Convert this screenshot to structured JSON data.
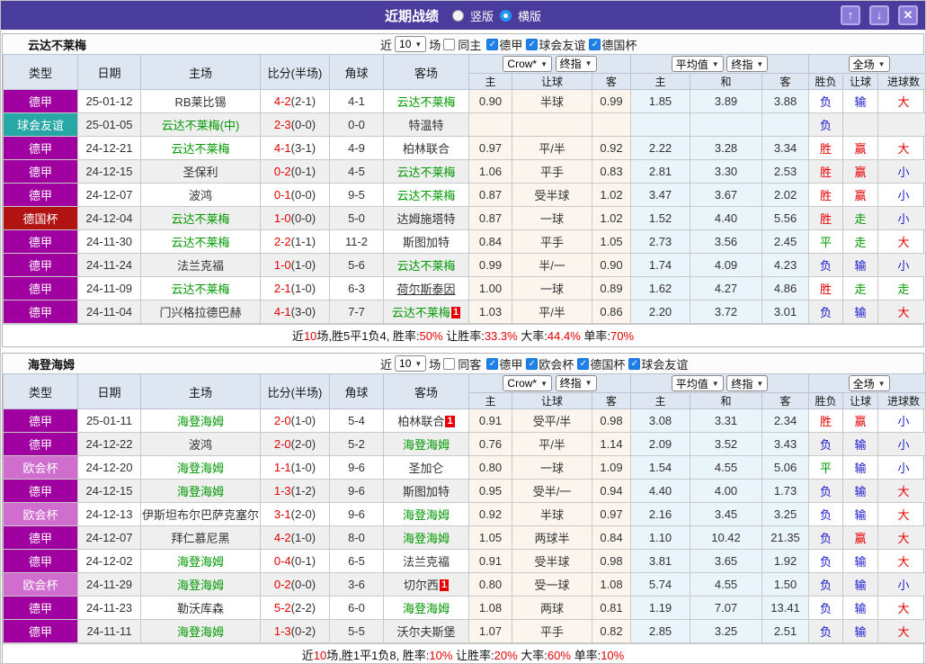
{
  "titlebar": {
    "title": "近期战绩",
    "radios": [
      {
        "label": "竖版",
        "selected": false
      },
      {
        "label": "横版",
        "selected": true
      }
    ],
    "buttons": [
      {
        "id": "up",
        "glyph": "↑"
      },
      {
        "id": "down",
        "glyph": "↓"
      },
      {
        "id": "close",
        "glyph": "✕"
      }
    ]
  },
  "headers": {
    "static": [
      "类型",
      "日期",
      "主场",
      "比分(半场)",
      "角球",
      "客场"
    ],
    "g1": {
      "selects": [
        "Crow*",
        "终指"
      ],
      "cols": [
        "主",
        "让球",
        "客"
      ]
    },
    "g2": {
      "selects": [
        "平均值",
        "终指"
      ],
      "cols": [
        "主",
        "和",
        "客"
      ]
    },
    "g3": {
      "selects": [
        "全场"
      ],
      "cols": [
        "胜负",
        "让球",
        "进球数"
      ]
    }
  },
  "colors": {
    "titlebar": "#4a3c9c",
    "league": {
      "德甲": "#a000a0",
      "球会友谊": "#28a7a7",
      "德国杯": "#b11212",
      "欧会杯": "#cf6ece"
    },
    "result": {
      "r": "#e60000",
      "b": "#1919cc",
      "g": "#009900"
    },
    "team_highlight": "#009900",
    "score_red": "#e60000"
  },
  "sections": [
    {
      "team": "云达不莱梅",
      "filter": {
        "near": "近",
        "count": "10",
        "unit": "场",
        "same_label": "同主",
        "same_checked": false,
        "leagues": [
          "德甲",
          "球会友谊",
          "德国杯"
        ]
      },
      "rows": [
        {
          "type": "德甲",
          "date": "25-01-12",
          "home": {
            "t": "RB莱比锡",
            "s": "n"
          },
          "score": {
            "m": "4-2",
            "h": "(2-1)"
          },
          "corners": "4-1",
          "away": {
            "t": "云达不莱梅",
            "s": "g"
          },
          "odds": [
            "0.90",
            "半球",
            "0.99"
          ],
          "avg": [
            "1.85",
            "3.89",
            "3.88"
          ],
          "res": [
            {
              "t": "负",
              "c": "b"
            },
            {
              "t": "输",
              "c": "b"
            },
            {
              "t": "大",
              "c": "r"
            }
          ]
        },
        {
          "type": "球会友谊",
          "date": "25-01-05",
          "home": {
            "t": "云达不莱梅(中)",
            "s": "g"
          },
          "score": {
            "m": "2-3",
            "h": "(0-0)"
          },
          "corners": "0-0",
          "away": {
            "t": "特温特",
            "s": "n"
          },
          "odds": [
            "",
            "",
            ""
          ],
          "avg": [
            "",
            "",
            ""
          ],
          "res": [
            {
              "t": "负",
              "c": "b"
            },
            {
              "t": "",
              "c": ""
            },
            {
              "t": "",
              "c": ""
            }
          ]
        },
        {
          "type": "德甲",
          "date": "24-12-21",
          "home": {
            "t": "云达不莱梅",
            "s": "g"
          },
          "score": {
            "m": "4-1",
            "h": "(3-1)"
          },
          "corners": "4-9",
          "away": {
            "t": "柏林联合",
            "s": "n"
          },
          "odds": [
            "0.97",
            "平/半",
            "0.92"
          ],
          "avg": [
            "2.22",
            "3.28",
            "3.34"
          ],
          "res": [
            {
              "t": "胜",
              "c": "r"
            },
            {
              "t": "赢",
              "c": "r"
            },
            {
              "t": "大",
              "c": "r"
            }
          ]
        },
        {
          "type": "德甲",
          "date": "24-12-15",
          "home": {
            "t": "圣保利",
            "s": "n"
          },
          "score": {
            "m": "0-2",
            "h": "(0-1)"
          },
          "corners": "4-5",
          "away": {
            "t": "云达不莱梅",
            "s": "g"
          },
          "odds": [
            "1.06",
            "平手",
            "0.83"
          ],
          "avg": [
            "2.81",
            "3.30",
            "2.53"
          ],
          "res": [
            {
              "t": "胜",
              "c": "r"
            },
            {
              "t": "赢",
              "c": "r"
            },
            {
              "t": "小",
              "c": "b"
            }
          ]
        },
        {
          "type": "德甲",
          "date": "24-12-07",
          "home": {
            "t": "波鸿",
            "s": "n"
          },
          "score": {
            "m": "0-1",
            "h": "(0-0)"
          },
          "corners": "9-5",
          "away": {
            "t": "云达不莱梅",
            "s": "g"
          },
          "odds": [
            "0.87",
            "受半球",
            "1.02"
          ],
          "avg": [
            "3.47",
            "3.67",
            "2.02"
          ],
          "res": [
            {
              "t": "胜",
              "c": "r"
            },
            {
              "t": "赢",
              "c": "r"
            },
            {
              "t": "小",
              "c": "b"
            }
          ]
        },
        {
          "type": "德国杯",
          "date": "24-12-04",
          "home": {
            "t": "云达不莱梅",
            "s": "g"
          },
          "score": {
            "m": "1-0",
            "h": "(0-0)"
          },
          "corners": "5-0",
          "away": {
            "t": "达姆施塔特",
            "s": "n"
          },
          "odds": [
            "0.87",
            "一球",
            "1.02"
          ],
          "avg": [
            "1.52",
            "4.40",
            "5.56"
          ],
          "res": [
            {
              "t": "胜",
              "c": "r"
            },
            {
              "t": "走",
              "c": "g"
            },
            {
              "t": "小",
              "c": "b"
            }
          ]
        },
        {
          "type": "德甲",
          "date": "24-11-30",
          "home": {
            "t": "云达不莱梅",
            "s": "g"
          },
          "score": {
            "m": "2-2",
            "h": "(1-1)"
          },
          "corners": "11-2",
          "away": {
            "t": "斯图加特",
            "s": "n"
          },
          "odds": [
            "0.84",
            "平手",
            "1.05"
          ],
          "avg": [
            "2.73",
            "3.56",
            "2.45"
          ],
          "res": [
            {
              "t": "平",
              "c": "g"
            },
            {
              "t": "走",
              "c": "g"
            },
            {
              "t": "大",
              "c": "r"
            }
          ]
        },
        {
          "type": "德甲",
          "date": "24-11-24",
          "home": {
            "t": "法兰克福",
            "s": "n"
          },
          "score": {
            "m": "1-0",
            "h": "(1-0)"
          },
          "corners": "5-6",
          "away": {
            "t": "云达不莱梅",
            "s": "g"
          },
          "odds": [
            "0.99",
            "半/一",
            "0.90"
          ],
          "avg": [
            "1.74",
            "4.09",
            "4.23"
          ],
          "res": [
            {
              "t": "负",
              "c": "b"
            },
            {
              "t": "输",
              "c": "b"
            },
            {
              "t": "小",
              "c": "b"
            }
          ]
        },
        {
          "type": "德甲",
          "date": "24-11-09",
          "home": {
            "t": "云达不莱梅",
            "s": "g"
          },
          "score": {
            "m": "2-1",
            "h": "(1-0)"
          },
          "corners": "6-3",
          "away": {
            "t": "荷尔斯泰因",
            "s": "u"
          },
          "odds": [
            "1.00",
            "一球",
            "0.89"
          ],
          "avg": [
            "1.62",
            "4.27",
            "4.86"
          ],
          "res": [
            {
              "t": "胜",
              "c": "r"
            },
            {
              "t": "走",
              "c": "g"
            },
            {
              "t": "走",
              "c": "g"
            }
          ]
        },
        {
          "type": "德甲",
          "date": "24-11-04",
          "home": {
            "t": "门兴格拉德巴赫",
            "s": "n"
          },
          "score": {
            "m": "4-1",
            "h": "(3-0)"
          },
          "corners": "7-7",
          "away": {
            "t": "云达不莱梅",
            "s": "g",
            "b": "1"
          },
          "odds": [
            "1.03",
            "平/半",
            "0.86"
          ],
          "avg": [
            "2.20",
            "3.72",
            "3.01"
          ],
          "res": [
            {
              "t": "负",
              "c": "b"
            },
            {
              "t": "输",
              "c": "b"
            },
            {
              "t": "大",
              "c": "r"
            }
          ]
        }
      ],
      "summary": [
        {
          "t": "近"
        },
        {
          "t": "10",
          "c": "r"
        },
        {
          "t": "场,胜5平1负4, 胜率:"
        },
        {
          "t": "50%",
          "c": "r"
        },
        {
          "t": " 让胜率:"
        },
        {
          "t": "33.3%",
          "c": "r"
        },
        {
          "t": " 大率:"
        },
        {
          "t": "44.4%",
          "c": "r"
        },
        {
          "t": " 单率:"
        },
        {
          "t": "70%",
          "c": "r"
        }
      ]
    },
    {
      "team": "海登海姆",
      "filter": {
        "near": "近",
        "count": "10",
        "unit": "场",
        "same_label": "同客",
        "same_checked": false,
        "leagues": [
          "德甲",
          "欧会杯",
          "德国杯",
          "球会友谊"
        ]
      },
      "rows": [
        {
          "type": "德甲",
          "date": "25-01-11",
          "home": {
            "t": "海登海姆",
            "s": "g"
          },
          "score": {
            "m": "2-0",
            "h": "(1-0)"
          },
          "corners": "5-4",
          "away": {
            "t": "柏林联合",
            "s": "n",
            "b": "1"
          },
          "odds": [
            "0.91",
            "受平/半",
            "0.98"
          ],
          "avg": [
            "3.08",
            "3.31",
            "2.34"
          ],
          "res": [
            {
              "t": "胜",
              "c": "r"
            },
            {
              "t": "赢",
              "c": "r"
            },
            {
              "t": "小",
              "c": "b"
            }
          ]
        },
        {
          "type": "德甲",
          "date": "24-12-22",
          "home": {
            "t": "波鸿",
            "s": "n"
          },
          "score": {
            "m": "2-0",
            "h": "(2-0)"
          },
          "corners": "5-2",
          "away": {
            "t": "海登海姆",
            "s": "g"
          },
          "odds": [
            "0.76",
            "平/半",
            "1.14"
          ],
          "avg": [
            "2.09",
            "3.52",
            "3.43"
          ],
          "res": [
            {
              "t": "负",
              "c": "b"
            },
            {
              "t": "输",
              "c": "b"
            },
            {
              "t": "小",
              "c": "b"
            }
          ]
        },
        {
          "type": "欧会杯",
          "date": "24-12-20",
          "home": {
            "t": "海登海姆",
            "s": "g"
          },
          "score": {
            "m": "1-1",
            "h": "(1-0)"
          },
          "corners": "9-6",
          "away": {
            "t": "圣加仑",
            "s": "n"
          },
          "odds": [
            "0.80",
            "一球",
            "1.09"
          ],
          "avg": [
            "1.54",
            "4.55",
            "5.06"
          ],
          "res": [
            {
              "t": "平",
              "c": "g"
            },
            {
              "t": "输",
              "c": "b"
            },
            {
              "t": "小",
              "c": "b"
            }
          ]
        },
        {
          "type": "德甲",
          "date": "24-12-15",
          "home": {
            "t": "海登海姆",
            "s": "g"
          },
          "score": {
            "m": "1-3",
            "h": "(1-2)"
          },
          "corners": "9-6",
          "away": {
            "t": "斯图加特",
            "s": "n"
          },
          "odds": [
            "0.95",
            "受半/一",
            "0.94"
          ],
          "avg": [
            "4.40",
            "4.00",
            "1.73"
          ],
          "res": [
            {
              "t": "负",
              "c": "b"
            },
            {
              "t": "输",
              "c": "b"
            },
            {
              "t": "大",
              "c": "r"
            }
          ]
        },
        {
          "type": "欧会杯",
          "date": "24-12-13",
          "home": {
            "t": "伊斯坦布尔巴萨克塞尔",
            "s": "n"
          },
          "score": {
            "m": "3-1",
            "h": "(2-0)"
          },
          "corners": "9-6",
          "away": {
            "t": "海登海姆",
            "s": "g"
          },
          "odds": [
            "0.92",
            "半球",
            "0.97"
          ],
          "avg": [
            "2.16",
            "3.45",
            "3.25"
          ],
          "res": [
            {
              "t": "负",
              "c": "b"
            },
            {
              "t": "输",
              "c": "b"
            },
            {
              "t": "大",
              "c": "r"
            }
          ]
        },
        {
          "type": "德甲",
          "date": "24-12-07",
          "home": {
            "t": "拜仁慕尼黑",
            "s": "n"
          },
          "score": {
            "m": "4-2",
            "h": "(1-0)"
          },
          "corners": "8-0",
          "away": {
            "t": "海登海姆",
            "s": "g"
          },
          "odds": [
            "1.05",
            "两球半",
            "0.84"
          ],
          "avg": [
            "1.10",
            "10.42",
            "21.35"
          ],
          "res": [
            {
              "t": "负",
              "c": "b"
            },
            {
              "t": "赢",
              "c": "r"
            },
            {
              "t": "大",
              "c": "r"
            }
          ]
        },
        {
          "type": "德甲",
          "date": "24-12-02",
          "home": {
            "t": "海登海姆",
            "s": "g"
          },
          "score": {
            "m": "0-4",
            "h": "(0-1)"
          },
          "corners": "6-5",
          "away": {
            "t": "法兰克福",
            "s": "n"
          },
          "odds": [
            "0.91",
            "受半球",
            "0.98"
          ],
          "avg": [
            "3.81",
            "3.65",
            "1.92"
          ],
          "res": [
            {
              "t": "负",
              "c": "b"
            },
            {
              "t": "输",
              "c": "b"
            },
            {
              "t": "大",
              "c": "r"
            }
          ]
        },
        {
          "type": "欧会杯",
          "date": "24-11-29",
          "home": {
            "t": "海登海姆",
            "s": "g"
          },
          "score": {
            "m": "0-2",
            "h": "(0-0)"
          },
          "corners": "3-6",
          "away": {
            "t": "切尔西",
            "s": "n",
            "b": "1"
          },
          "odds": [
            "0.80",
            "受一球",
            "1.08"
          ],
          "avg": [
            "5.74",
            "4.55",
            "1.50"
          ],
          "res": [
            {
              "t": "负",
              "c": "b"
            },
            {
              "t": "输",
              "c": "b"
            },
            {
              "t": "小",
              "c": "b"
            }
          ]
        },
        {
          "type": "德甲",
          "date": "24-11-23",
          "home": {
            "t": "勒沃库森",
            "s": "n"
          },
          "score": {
            "m": "5-2",
            "h": "(2-2)"
          },
          "corners": "6-0",
          "away": {
            "t": "海登海姆",
            "s": "g"
          },
          "odds": [
            "1.08",
            "两球",
            "0.81"
          ],
          "avg": [
            "1.19",
            "7.07",
            "13.41"
          ],
          "res": [
            {
              "t": "负",
              "c": "b"
            },
            {
              "t": "输",
              "c": "b"
            },
            {
              "t": "大",
              "c": "r"
            }
          ]
        },
        {
          "type": "德甲",
          "date": "24-11-11",
          "home": {
            "t": "海登海姆",
            "s": "g"
          },
          "score": {
            "m": "1-3",
            "h": "(0-2)"
          },
          "corners": "5-5",
          "away": {
            "t": "沃尔夫斯堡",
            "s": "n"
          },
          "odds": [
            "1.07",
            "平手",
            "0.82"
          ],
          "avg": [
            "2.85",
            "3.25",
            "2.51"
          ],
          "res": [
            {
              "t": "负",
              "c": "b"
            },
            {
              "t": "输",
              "c": "b"
            },
            {
              "t": "大",
              "c": "r"
            }
          ]
        }
      ],
      "summary": [
        {
          "t": "近"
        },
        {
          "t": "10",
          "c": "r"
        },
        {
          "t": "场,胜1平1负8, 胜率:"
        },
        {
          "t": "10%",
          "c": "r"
        },
        {
          "t": " 让胜率:"
        },
        {
          "t": "20%",
          "c": "r"
        },
        {
          "t": " 大率:"
        },
        {
          "t": "60%",
          "c": "r"
        },
        {
          "t": " 单率:"
        },
        {
          "t": "10%",
          "c": "r"
        }
      ]
    }
  ]
}
